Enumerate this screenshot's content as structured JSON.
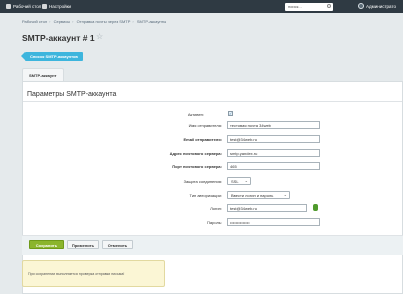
{
  "topbar": {
    "site_label": "Рабочий стол",
    "settings_label": "Настройки",
    "search_placeholder": "поиск...",
    "user_name": "Администрато"
  },
  "breadcrumbs": [
    "Рабочий стол",
    "Сервисы",
    "Отправка почты через SMTP",
    "SMTP-аккаунты"
  ],
  "page_title": "SMTP-аккаунт # 1",
  "list_button": "Список SMTP-аккаунтов",
  "tab": "SMTP-аккаунт",
  "section_title": "Параметры SMTP-аккаунта",
  "form": {
    "active_label": "Активен:",
    "active_checked": "✓",
    "sender_name_label": "Имя отправителя:",
    "sender_name_value": "тестовая почта 34web",
    "sender_email_label": "Email отправителя:",
    "sender_email_value": "test@34web.ru",
    "server_label": "Адрес почтового сервера:",
    "server_value": "smtp.yandex.ru",
    "port_label": "Порт почтового сервера:",
    "port_value": "465",
    "security_label": "Защита соединения:",
    "security_value": "SSL",
    "auth_label": "Тип авторизации:",
    "auth_value": "Ввести логин и пароль",
    "login_label": "Логин:",
    "login_value": "test@34web.ru",
    "password_label": "Пароль:",
    "password_value": "••••••••••••••"
  },
  "buttons": {
    "save": "Сохранить",
    "apply": "Применить",
    "cancel": "Отменить"
  },
  "notice": "При сохранении выполняется проверка отправки письма!"
}
